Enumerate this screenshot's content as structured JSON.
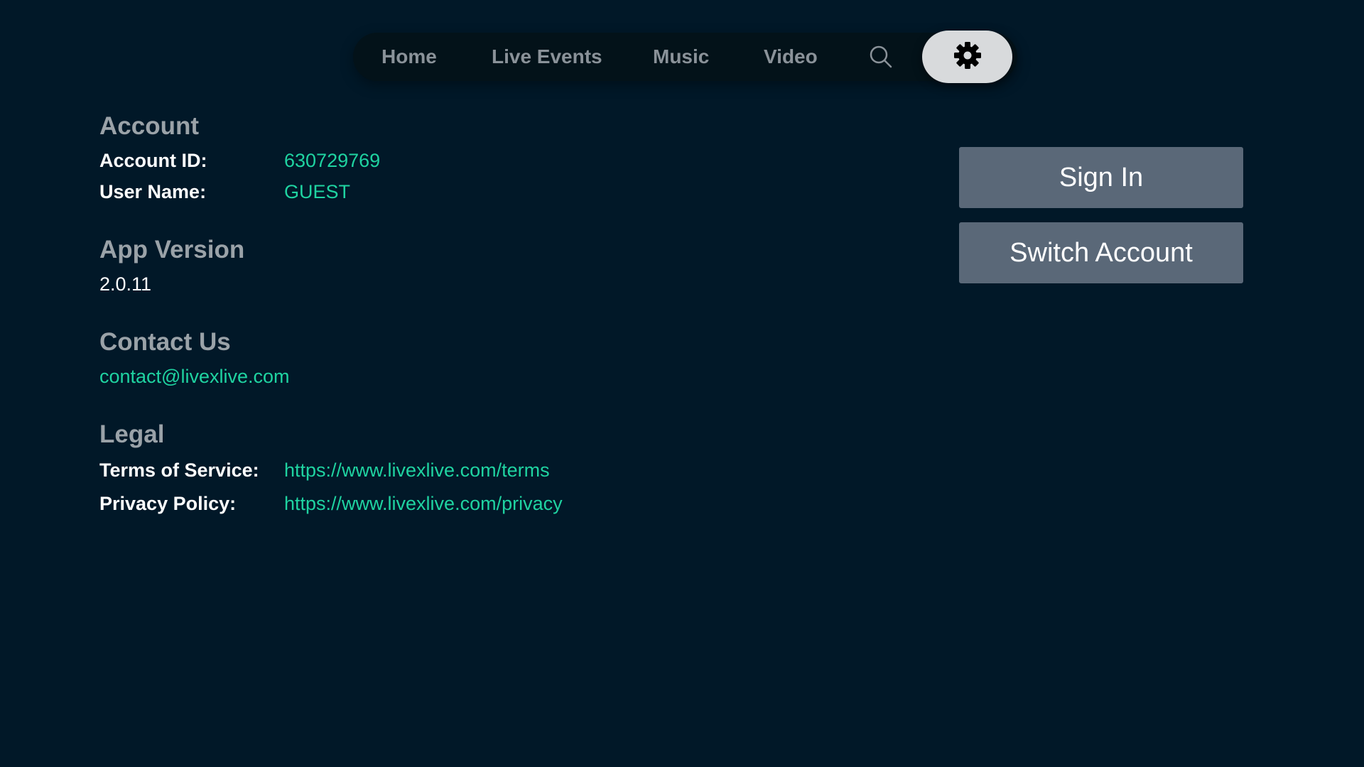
{
  "nav": {
    "items": [
      {
        "label": "Home"
      },
      {
        "label": "Live Events"
      },
      {
        "label": "Music"
      },
      {
        "label": "Video"
      }
    ],
    "search_icon": "search-icon",
    "settings_icon": "gear-icon"
  },
  "account": {
    "title": "Account",
    "id_label": "Account ID:",
    "id_value": "630729769",
    "user_label": "User Name:",
    "user_value": "GUEST"
  },
  "app_version": {
    "title": "App Version",
    "value": "2.0.11"
  },
  "contact": {
    "title": "Contact Us",
    "email": "contact@livexlive.com"
  },
  "legal": {
    "title": "Legal",
    "terms_label": "Terms of Service:",
    "terms_url": "https://www.livexlive.com/terms",
    "privacy_label": "Privacy Policy:",
    "privacy_url": "https://www.livexlive.com/privacy"
  },
  "actions": {
    "sign_in": "Sign In",
    "switch_account": "Switch Account"
  },
  "colors": {
    "background": "#011828",
    "accent": "#1fd3a1",
    "button": "#5a6878"
  }
}
